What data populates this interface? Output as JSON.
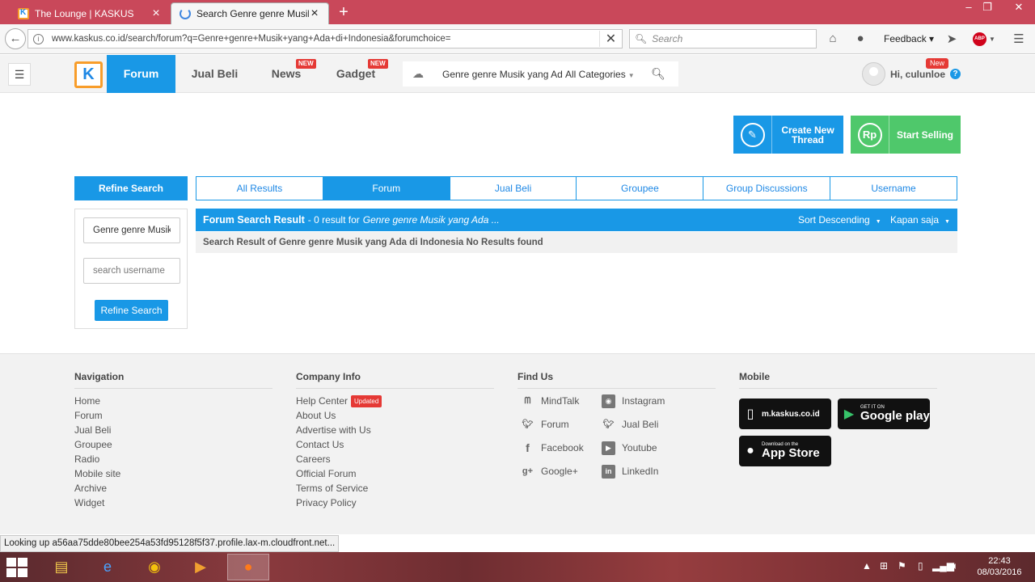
{
  "browser": {
    "tabs": [
      {
        "title": "The Lounge | KASKUS"
      },
      {
        "title": "Search Genre genre Musik..."
      }
    ],
    "url": "www.kaskus.co.id/search/forum?q=Genre+genre+Musik+yang+Ada+di+Indonesia&forumchoice=",
    "search_placeholder": "Search",
    "feedback_label": "Feedback",
    "abp_label": "ABP"
  },
  "header": {
    "logo": "K",
    "nav": [
      {
        "label": "Forum",
        "badge": ""
      },
      {
        "label": "Jual Beli",
        "badge": ""
      },
      {
        "label": "News",
        "badge": "NEW"
      },
      {
        "label": "Gadget",
        "badge": "NEW"
      }
    ],
    "search_query": "Genre genre Musik yang Ada",
    "category": "All Categories",
    "greeting": "Hi, culunloe",
    "new_badge": "New",
    "help": "?"
  },
  "actions": {
    "create_thread": "Create New Thread",
    "start_selling": "Start Selling",
    "rp": "Rp"
  },
  "search": {
    "refine_title": "Refine Search",
    "tabs": [
      "All Results",
      "Forum",
      "Jual Beli",
      "Groupee",
      "Group Discussions",
      "Username"
    ],
    "keyword_value": "Genre genre Musik",
    "username_placeholder": "search username",
    "refine_button": "Refine Search"
  },
  "results": {
    "title": "Forum Search Result",
    "count_text": "- 0 result for",
    "query_text": "Genre genre Musik yang Ada ...",
    "sort_label": "Sort Descending",
    "time_label": "Kapan saja",
    "message": "Search Result of Genre genre Musik yang Ada di Indonesia No Results found"
  },
  "footer": {
    "navigation": {
      "title": "Navigation",
      "links": [
        "Home",
        "Forum",
        "Jual Beli",
        "Groupee",
        "Radio",
        "Mobile site",
        "Archive",
        "Widget"
      ]
    },
    "company": {
      "title": "Company Info",
      "links": [
        "Help Center",
        "About Us",
        "Advertise with Us",
        "Contact Us",
        "Careers",
        "Official Forum",
        "Terms of Service",
        "Privacy Policy"
      ],
      "updated_badge": "Updated"
    },
    "find_us": {
      "title": "Find Us",
      "items": [
        {
          "label": "MindTalk",
          "icon": "mindtalk-icon"
        },
        {
          "label": "Instagram",
          "icon": "instagram-icon"
        },
        {
          "label": "Forum",
          "icon": "twitter-icon"
        },
        {
          "label": "Jual Beli",
          "icon": "twitter-icon"
        },
        {
          "label": "Facebook",
          "icon": "facebook-icon"
        },
        {
          "label": "Youtube",
          "icon": "youtube-icon"
        },
        {
          "label": "Google+",
          "icon": "googleplus-icon"
        },
        {
          "label": "LinkedIn",
          "icon": "linkedin-icon"
        }
      ]
    },
    "mobile": {
      "title": "Mobile",
      "mobile_site": "m.kaskus.co.id",
      "google_small": "GET IT ON",
      "google_big": "Google play",
      "apple_small": "Download on the",
      "apple_big": "App Store"
    }
  },
  "status_text": "Looking up a56aa75dde80bee254a53fd95128f5f37.profile.lax-m.cloudfront.net...",
  "taskbar": {
    "time": "22:43",
    "date": "08/03/2016"
  }
}
